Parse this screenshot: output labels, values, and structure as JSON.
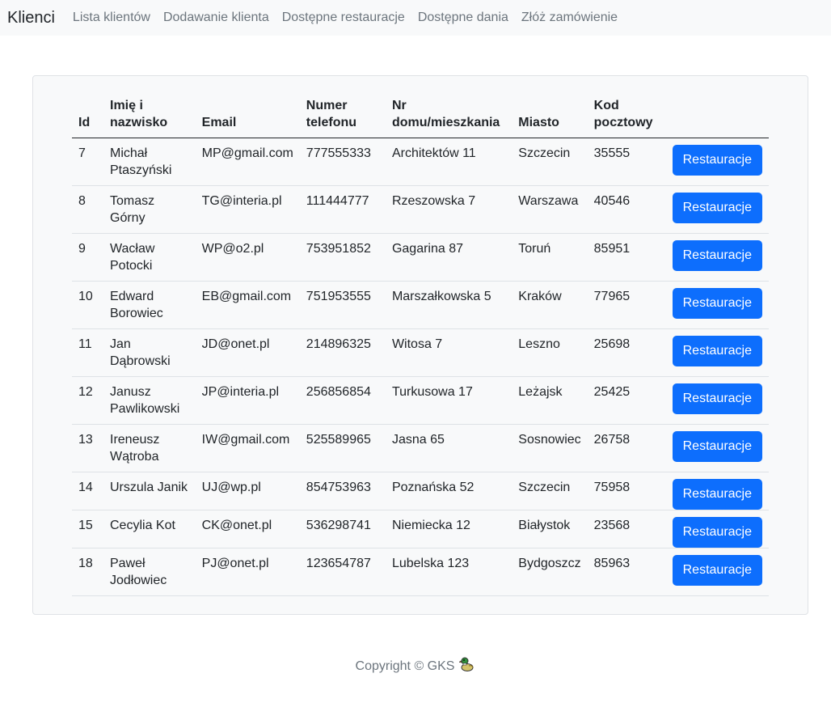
{
  "nav": {
    "brand": "Klienci",
    "links": [
      "Lista klientów",
      "Dodawanie klienta",
      "Dostępne restauracje",
      "Dostępne dania",
      "Złóż zamówienie"
    ]
  },
  "table": {
    "headers": [
      "Id",
      "Imię i nazwisko",
      "Email",
      "Numer telefonu",
      "Nr domu/mieszkania",
      "Miasto",
      "Kod pocztowy"
    ],
    "button_label": "Restauracje",
    "rows": [
      [
        "7",
        "Michał Ptaszyński",
        "MP@gmail.com",
        "777555333",
        "Architektów 11",
        "Szczecin",
        "35555"
      ],
      [
        "8",
        "Tomasz Górny",
        "TG@interia.pl",
        "111444777",
        "Rzeszowska 7",
        "Warszawa",
        "40546"
      ],
      [
        "9",
        "Wacław Potocki",
        "WP@o2.pl",
        "753951852",
        "Gagarina 87",
        "Toruń",
        "85951"
      ],
      [
        "10",
        "Edward Borowiec",
        "EB@gmail.com",
        "751953555",
        "Marszałkowska 5",
        "Kraków",
        "77965"
      ],
      [
        "11",
        "Jan Dąbrowski",
        "JD@onet.pl",
        "214896325",
        "Witosa 7",
        "Leszno",
        "25698"
      ],
      [
        "12",
        "Janusz Pawlikowski",
        "JP@interia.pl",
        "256856854",
        "Turkusowa 17",
        "Leżajsk",
        "25425"
      ],
      [
        "13",
        "Ireneusz Wątroba",
        "IW@gmail.com",
        "525589965",
        "Jasna 65",
        "Sosnowiec",
        "26758"
      ],
      [
        "14",
        "Urszula Janik",
        "UJ@wp.pl",
        "854753963",
        "Poznańska 52",
        "Szczecin",
        "75958"
      ],
      [
        "15",
        "Cecylia Kot",
        "CK@onet.pl",
        "536298741",
        "Niemiecka 12",
        "Białystok",
        "23568"
      ],
      [
        "18",
        "Paweł Jodłowiec",
        "PJ@onet.pl",
        "123654787",
        "Lubelska 123",
        "Bydgoszcz",
        "85963"
      ]
    ]
  },
  "footer": {
    "text": "Copyright © GKS",
    "logo_icon": "duck-icon"
  },
  "colors": {
    "primary": "#0d6efd",
    "navbar_bg": "#f8f9fa",
    "muted": "#6c757d"
  }
}
